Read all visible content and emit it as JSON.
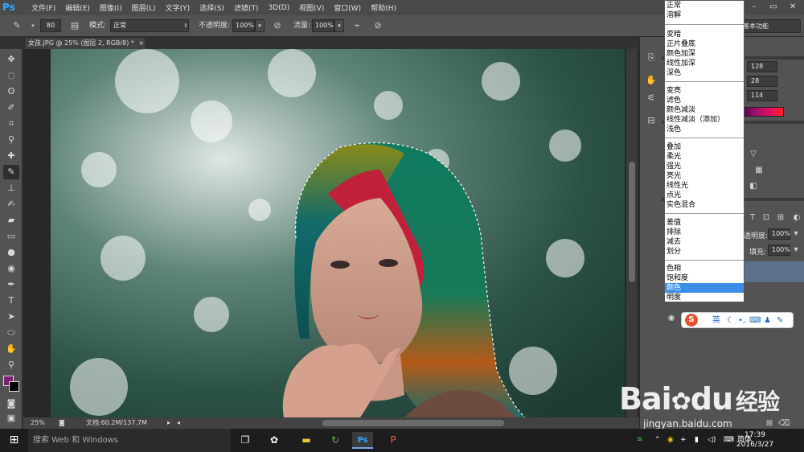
{
  "app": {
    "logo": "Ps",
    "menus": [
      "文件(F)",
      "编辑(E)",
      "图像(I)",
      "图层(L)",
      "文字(Y)",
      "选择(S)",
      "滤镜(T)",
      "3D(D)",
      "视图(V)",
      "窗口(W)",
      "帮助(H)"
    ],
    "window_controls": [
      "–",
      "▭",
      "✕"
    ]
  },
  "options": {
    "brush_size": "80",
    "mode_label": "模式:",
    "mode_value": "正常",
    "opacity_label": "不透明度:",
    "opacity_value": "100%",
    "flow_label": "流量:",
    "flow_value": "100%",
    "workspace": "基本功能"
  },
  "document": {
    "tab_title": "女孩.JPG @ 25% (图层 2, RGB/8) *",
    "tab_close": "×",
    "zoom": "25%",
    "doc_info": "文档:60.2M/137.7M"
  },
  "color_panel": {
    "values": [
      "128",
      "28",
      "114"
    ],
    "foreground_color": "#7a1e6e",
    "background_color": "#000000"
  },
  "layers_panel": {
    "opacity_label": "透明度:",
    "opacity_value": "100%",
    "fill_label": "填充:",
    "fill_value": "100%"
  },
  "blend_menu": {
    "groups": [
      [
        "正常",
        "溶解"
      ],
      [
        "变暗",
        "正片叠底",
        "颜色加深",
        "线性加深",
        "深色"
      ],
      [
        "变亮",
        "滤色",
        "颜色减淡",
        "线性减淡（添加）",
        "浅色"
      ],
      [
        "叠加",
        "柔光",
        "强光",
        "亮光",
        "线性光",
        "点光",
        "实色混合"
      ],
      [
        "差值",
        "排除",
        "减去",
        "划分"
      ],
      [
        "色相",
        "饱和度",
        "颜色",
        "明度"
      ]
    ],
    "selected": "颜色"
  },
  "ime": {
    "label": "英",
    "logo": "S"
  },
  "watermark": {
    "brand": "Bai",
    "brand2": "du",
    "cn": "经验",
    "url": "jingyan.baidu.com"
  },
  "taskbar": {
    "search_placeholder": "搜索 Web 和 Windows",
    "ime_lang": "简体",
    "time": "17:39",
    "date": "2016/3/27"
  }
}
